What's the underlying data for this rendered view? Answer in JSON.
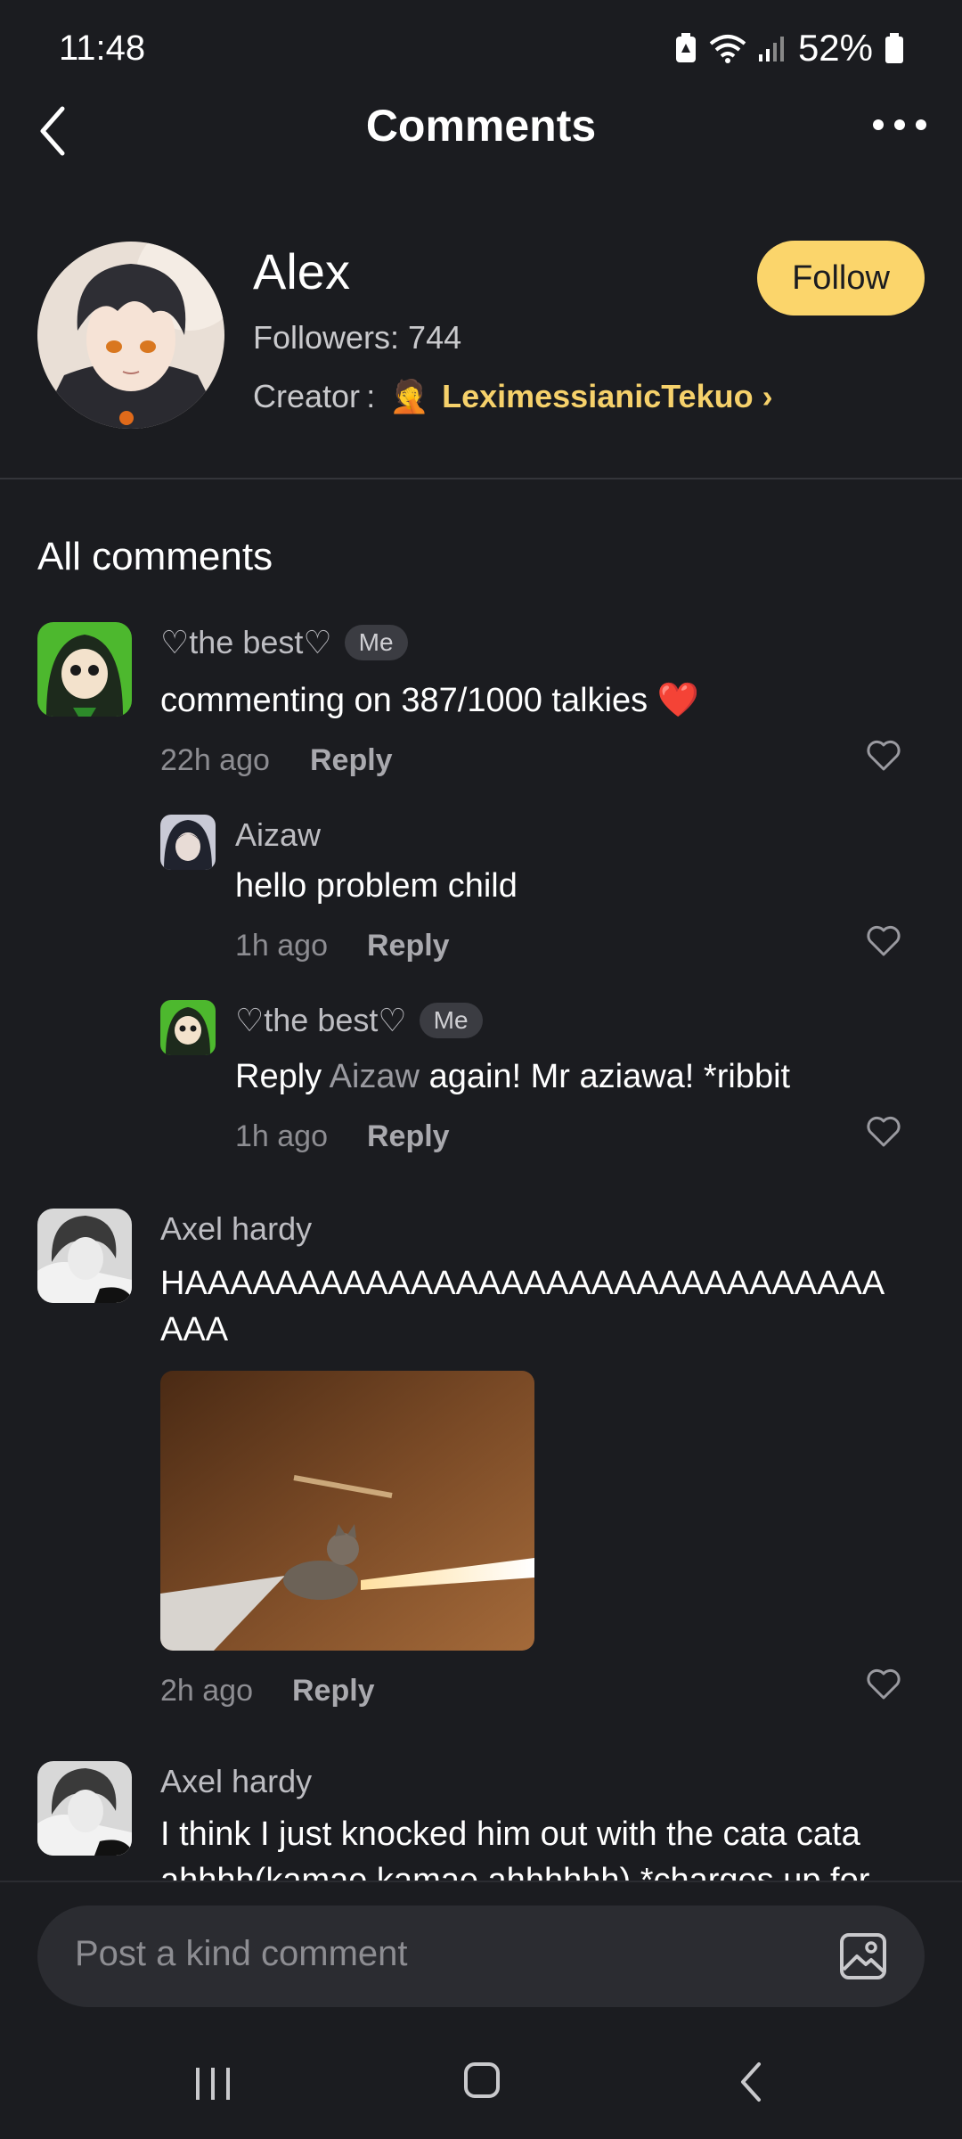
{
  "status_bar": {
    "time": "11:48",
    "battery": "52%"
  },
  "header": {
    "title": "Comments"
  },
  "profile": {
    "name": "Alex",
    "followers": "Followers: 744",
    "creator_label": "Creator :",
    "creator_emoji": "🤦",
    "creator_name": "LeximessianicTekuo",
    "creator_chevron": "›",
    "follow_label": "Follow"
  },
  "section_title": "All comments",
  "comments": [
    {
      "author": "♡the best♡",
      "badge": "Me",
      "text": "commenting on 387/1000 talkies",
      "emoji": "❤️",
      "time": "22h ago",
      "reply_label": "Reply"
    },
    {
      "author": "Aizaw",
      "text": "hello problem child",
      "time": "1h ago",
      "reply_label": "Reply"
    },
    {
      "author": "♡the best♡",
      "badge": "Me",
      "text_prefix": "Reply",
      "mention": "Aizaw",
      "text": "again! Mr aziawa! *ribbit",
      "time": "1h ago",
      "reply_label": "Reply"
    },
    {
      "author": "Axel hardy",
      "text_line1": "HAAAAAAAAAAAAAAAAAAAAAAAAAAAAAAA",
      "text_line2": "AAA",
      "time": "2h ago",
      "reply_label": "Reply"
    },
    {
      "author": "Axel hardy",
      "text_line1": "I think I just knocked him out with the cata cata",
      "text_line2": "ahhhh(kamae kamae ahhhhhh) *charges up for"
    }
  ],
  "composer": {
    "placeholder": "Post a kind comment"
  },
  "colors": {
    "accent": "#fbd56b",
    "background": "#1b1c20"
  }
}
